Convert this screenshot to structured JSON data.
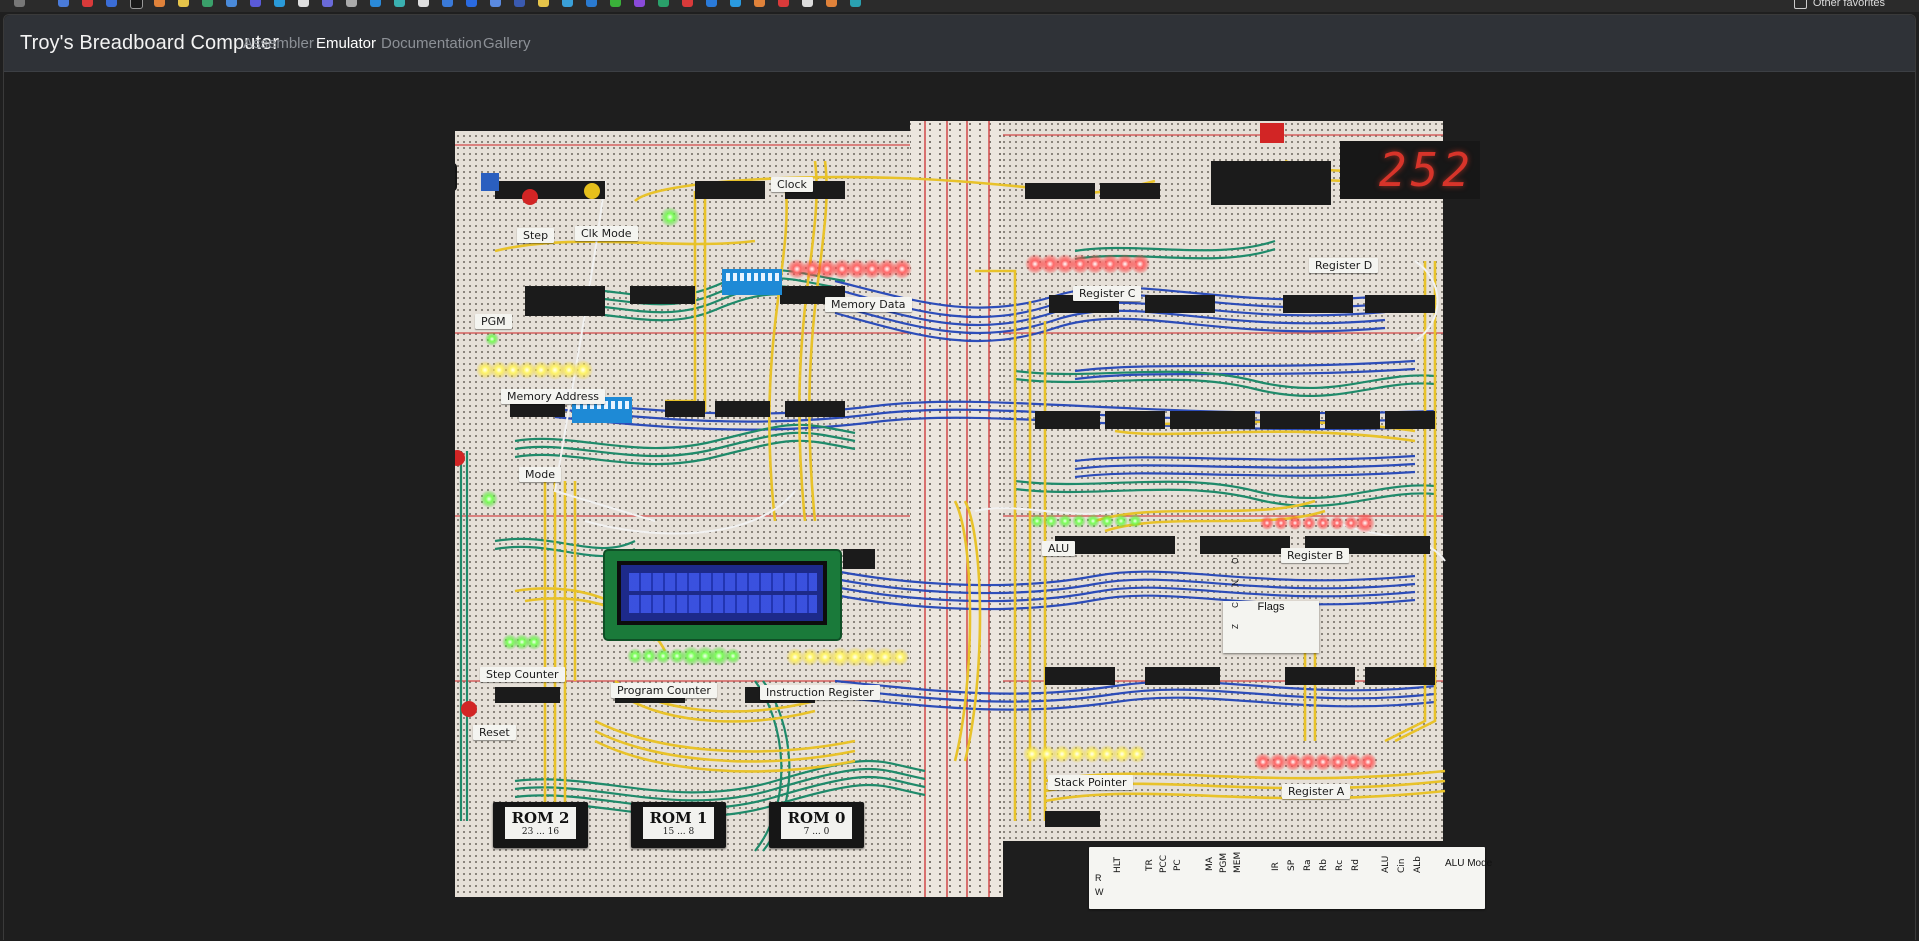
{
  "navbar": {
    "brand": "Troy's Breadboard Computer",
    "items": [
      {
        "label": "Assembler",
        "active": false
      },
      {
        "label": "Emulator",
        "active": true
      },
      {
        "label": "Documentation",
        "active": false
      },
      {
        "label": "Gallery",
        "active": false
      }
    ]
  },
  "bookmarks": {
    "folder_label": "Other favorites"
  },
  "board": {
    "display_value": "252",
    "labels": {
      "step": "Step",
      "clk_mode": "Clk Mode",
      "clock": "Clock",
      "memory_data": "Memory Data",
      "register_c": "Register C",
      "register_d": "Register D",
      "pgm": "PGM",
      "memory_address": "Memory Address",
      "mode": "Mode",
      "alu": "ALU",
      "register_b": "Register B",
      "flags": "Flags",
      "flags_letters": "Z C N O",
      "step_counter": "Step Counter",
      "program_counter": "Program Counter",
      "instruction_register": "Instruction Register",
      "reset": "Reset",
      "stack_pointer": "Stack Pointer",
      "register_a": "Register A"
    },
    "roms": [
      {
        "title": "ROM 2",
        "range": "23 ... 16"
      },
      {
        "title": "ROM 1",
        "range": "15 ... 8"
      },
      {
        "title": "ROM 0",
        "range": "7 ... 0"
      }
    ],
    "control_panel": {
      "signals": [
        "HLT",
        "TR",
        "PCC",
        "PC",
        "MA",
        "PGM",
        "MEM",
        "IR",
        "SP",
        "Ra",
        "Rb",
        "Rc",
        "Rd",
        "ALU",
        "Cin",
        "ALb"
      ],
      "mode_label": "ALU Mode",
      "rw_r": "R",
      "rw_w": "W"
    }
  },
  "colors": {
    "navbar_bg": "#2f3237",
    "page_bg": "#1e1e1e",
    "breadboard": "#e9e4dc",
    "wire_yellow": "#e8c22a",
    "wire_green": "#1f8a6a",
    "wire_blue": "#2446b8",
    "led_red": "#ff4a4a",
    "led_green": "#6dff4a",
    "led_yellow": "#fff36a"
  }
}
